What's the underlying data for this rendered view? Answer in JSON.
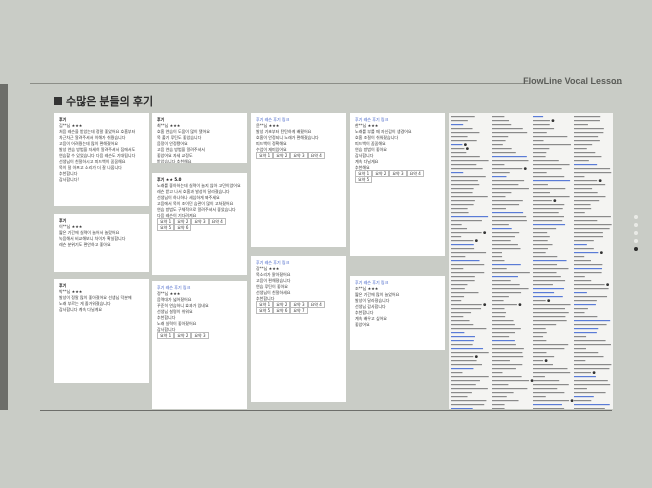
{
  "brand": "FlowLine Vocal Lesson",
  "title": "수많은 분들의 후기",
  "pagination": {
    "count": 5,
    "active": 4
  },
  "cards": [
    {
      "id": "c1",
      "lines": [
        "후기",
        "",
        "  김**님 ★★★",
        "처음 레슨을 받았는데 정말 좋았어요 호흡부터",
        "차근차근 알려주셔서 이해가 쉬웠습니다",
        "고음이 어려웠는데 많이 편해졌어요",
        "발성 연습 방법을 자세히 알려주셔서 집에서도",
        "연습할 수 있었습니다 다음 레슨도 기대됩니다",
        "선생님이 친절하시고 피드백이 꼼꼼해요",
        "목이 덜 아프고 소리가 더 잘 나옵니다",
        "추천합니다",
        "감사합니다!"
      ]
    },
    {
      "id": "c2",
      "lines": [
        "후기",
        "",
        "  이**님 ★★★",
        "짧은 기간에 실력이 늘어서 놀랐어요",
        "녹음해서 비교해보니 차이가 확실합니다",
        "레슨 분위기도 편안하고 좋아요"
      ]
    },
    {
      "id": "c3",
      "lines": [
        "후기",
        "박**님 ★★★",
        "발성이 정말 많이 좋아졌어요 선생님 덕분에",
        "노래 부르는 게 즐거워졌습니다",
        "감사합니다 계속 다닐게요"
      ]
    },
    {
      "id": "c4",
      "lines": [
        "후기",
        "",
        "최**님 ★★★",
        "호흡 연습이 도움이 많이 됐어요",
        "목 풀기 루틴도 좋았습니다",
        "음정이 안정됐어요",
        "고음 연습 방법을 알려주셔서",
        "좋았어요 자세 교정도",
        "받았습니다 추천해요",
        "수업 시간이 빨리 가요",
        "만족합니다",
        "다음에도 신청할게요",
        "친구에게도 추천했어요",
        "정말 감사합니다"
      ]
    },
    {
      "id": "c5",
      "lines": [
        "후기 ★★ 5.0",
        "노래를 좋아하는데 실력이 늘지 않아 고민이었어요",
        "레슨 받고 나서 호흡과 발성이 달라졌습니다",
        "선생님이 하나하나 세심하게 봐주세요",
        "고음에서 목이 조이던 습관이 많이 고쳐졌어요",
        "연습 방법도 구체적으로 알려주셔서 좋았습니다",
        "다음 레슨이 기다려져요",
        "",
        "요약 1",
        "요약 2",
        "요약 3",
        "요약 4",
        "요약 5",
        "요약 6"
      ]
    },
    {
      "id": "c6",
      "lines": [
        "후기 레슨 후기 링크",
        "",
        "정**님 ★★★",
        "음역대가 넓어졌어요",
        "꾸준히 연습하니 효과가 있네요",
        "선생님 설명이 쉬워요",
        "추천합니다",
        "노래 실력이 좋아졌어요",
        "감사합니다",
        "",
        "요약 1",
        "요약 2",
        "요약 3"
      ]
    },
    {
      "id": "c7",
      "lines": [
        "후기 레슨 후기 링크",
        "윤**님 ★★★",
        "발성 기초부터 탄탄하게 배웠어요",
        "호흡이 안정되니 노래가 편해졌습니다",
        "피드백이 정확해요",
        "수업이 재미있어요",
        "",
        "요약 1",
        "요약 2",
        "요약 3",
        "요약 4"
      ]
    },
    {
      "id": "c8",
      "lines": [
        "후기 레슨 후기 링크",
        "강**님 ★★★",
        "목소리가 맑아졌어요",
        "고음이 편해졌습니다",
        "연습 루틴이 좋아요",
        "선생님이 친절하세요",
        "추천합니다",
        "",
        "요약 1",
        "요약 2",
        "요약 3",
        "요약 4",
        "요약 5",
        "요약 6",
        "요약 7"
      ]
    },
    {
      "id": "c9",
      "lines": [
        "후기 레슨 후기 링크",
        "",
        "한**님 ★★★",
        "노래를 부를 때 자신감이 생겼어요",
        "호흡 조절이 쉬워졌습니다",
        "피드백이 꼼꼼해요",
        "연습 방법이 좋아요",
        "감사합니다",
        "계속 다닐게요",
        "추천해요",
        "",
        "요약 1",
        "요약 2",
        "요약 3",
        "요약 4",
        "요약 5"
      ]
    },
    {
      "id": "c10",
      "lines": [
        "후기 레슨 후기 링크",
        "",
        "조**님 ★★★",
        "짧은 기간에 많이 늘었어요",
        "발성이 달라졌습니다",
        "선생님 감사합니다",
        "추천합니다",
        "계속 배우고 싶어요",
        "좋았어요"
      ]
    }
  ]
}
